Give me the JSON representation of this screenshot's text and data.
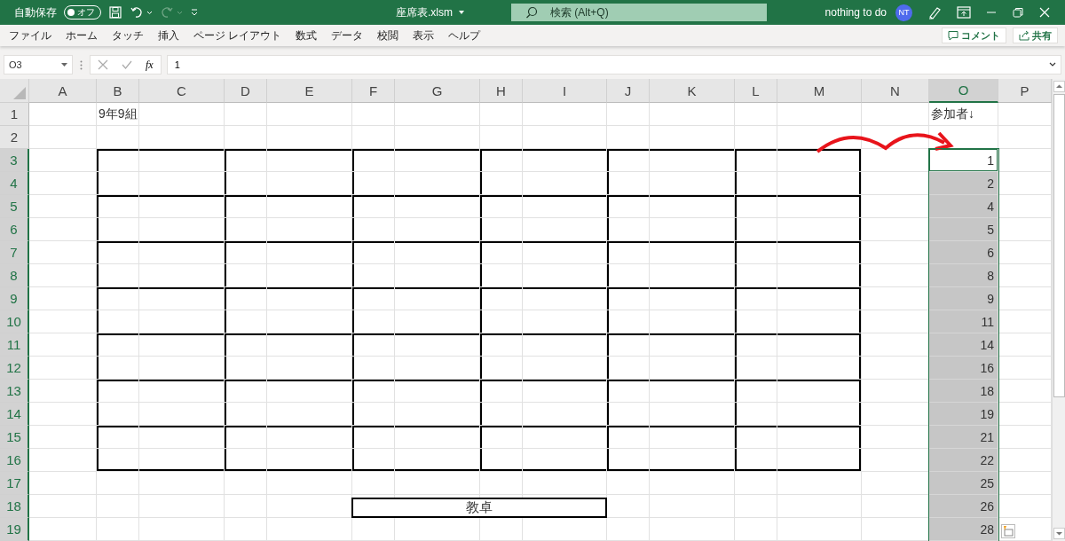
{
  "title_bar": {
    "autosave_label": "自動保存",
    "autosave_toggle": {
      "label": "オフ",
      "on": false
    },
    "undo_disabled": false,
    "redo_disabled": true,
    "file_name": "座席表.xlsm",
    "search": {
      "placeholder": "検索 (Alt+Q)"
    },
    "user_name": "nothing to do",
    "avatar": "NT"
  },
  "menu": {
    "tabs": [
      "ファイル",
      "ホーム",
      "タッチ",
      "挿入",
      "ページ レイアウト",
      "数式",
      "データ",
      "校閲",
      "表示",
      "ヘルプ"
    ],
    "buttons": [
      "コメント",
      "共有"
    ]
  },
  "formula_bar": {
    "name_box": "O3",
    "fx": "fx",
    "value": "1"
  },
  "sheet": {
    "columns": [
      {
        "label": "A",
        "selected": false
      },
      {
        "label": "B",
        "selected": false
      },
      {
        "label": "C",
        "selected": false
      },
      {
        "label": "D",
        "selected": false
      },
      {
        "label": "E",
        "selected": false
      },
      {
        "label": "F",
        "selected": false
      },
      {
        "label": "G",
        "selected": false
      },
      {
        "label": "H",
        "selected": false
      },
      {
        "label": "I",
        "selected": false
      },
      {
        "label": "J",
        "selected": false
      },
      {
        "label": "K",
        "selected": false
      },
      {
        "label": "L",
        "selected": false
      },
      {
        "label": "M",
        "selected": false
      },
      {
        "label": "N",
        "selected": false
      },
      {
        "label": "O",
        "selected": true
      },
      {
        "label": "P",
        "selected": false
      }
    ],
    "rows": [
      {
        "label": "1",
        "selected": false,
        "labels": {
          "B": "9年9組",
          "O": "参加者↓"
        }
      },
      {
        "label": "2",
        "selected": false
      },
      {
        "label": "3",
        "selected": true,
        "values": {
          "O": {
            "text": "1",
            "active": true
          }
        }
      },
      {
        "label": "4",
        "selected": true,
        "values": {
          "O": {
            "text": "2",
            "active": false
          }
        }
      },
      {
        "label": "5",
        "selected": true,
        "values": {
          "O": {
            "text": "4",
            "active": false
          }
        }
      },
      {
        "label": "6",
        "selected": true,
        "values": {
          "O": {
            "text": "5",
            "active": false
          }
        }
      },
      {
        "label": "7",
        "selected": true,
        "values": {
          "O": {
            "text": "6",
            "active": false
          }
        }
      },
      {
        "label": "8",
        "selected": true,
        "values": {
          "O": {
            "text": "8",
            "active": false
          }
        }
      },
      {
        "label": "9",
        "selected": true,
        "values": {
          "O": {
            "text": "9",
            "active": false
          }
        }
      },
      {
        "label": "10",
        "selected": true,
        "values": {
          "O": {
            "text": "11",
            "active": false
          }
        }
      },
      {
        "label": "11",
        "selected": true,
        "values": {
          "O": {
            "text": "14",
            "active": false
          }
        }
      },
      {
        "label": "12",
        "selected": true,
        "values": {
          "O": {
            "text": "16",
            "active": false
          }
        }
      },
      {
        "label": "13",
        "selected": true,
        "values": {
          "O": {
            "text": "18",
            "active": false
          }
        }
      },
      {
        "label": "14",
        "selected": true,
        "values": {
          "O": {
            "text": "19",
            "active": false
          }
        }
      },
      {
        "label": "15",
        "selected": true,
        "values": {
          "O": {
            "text": "21",
            "active": false
          }
        }
      },
      {
        "label": "16",
        "selected": true,
        "values": {
          "O": {
            "text": "22",
            "active": false
          }
        }
      },
      {
        "label": "17",
        "selected": true,
        "values": {
          "O": {
            "text": "25",
            "active": false
          }
        }
      },
      {
        "label": "18",
        "selected": true,
        "values": {
          "O": {
            "text": "26",
            "active": false
          }
        }
      },
      {
        "label": "19",
        "selected": true,
        "values": {
          "O": {
            "text": "28",
            "active": false
          }
        }
      }
    ],
    "teacher_desk": {
      "label": "教卓"
    }
  }
}
